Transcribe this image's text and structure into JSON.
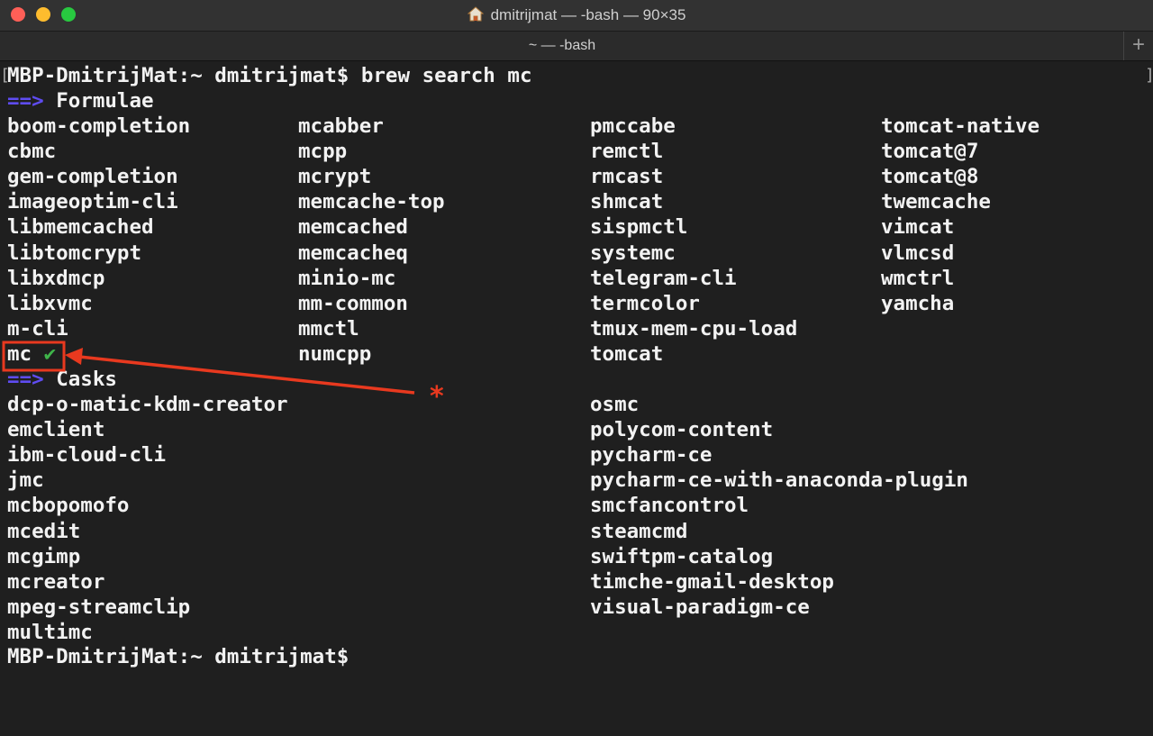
{
  "window": {
    "title": "dmitrijmat — -bash — 90×35",
    "tab_label": "~ — -bash",
    "new_tab_label": "+"
  },
  "terminal": {
    "prompt_command": "MBP-DmitrijMat:~ dmitrijmat$ brew search mc",
    "formulae_marker": "==>",
    "formulae_header": "Formulae",
    "formulae": [
      [
        "boom-completion",
        "mcabber",
        "pmccabe",
        "tomcat-native"
      ],
      [
        "cbmc",
        "mcpp",
        "remctl",
        "tomcat@7"
      ],
      [
        "gem-completion",
        "mcrypt",
        "rmcast",
        "tomcat@8"
      ],
      [
        "imageoptim-cli",
        "memcache-top",
        "shmcat",
        "twemcache"
      ],
      [
        "libmemcached",
        "memcached",
        "sispmctl",
        "vimcat"
      ],
      [
        "libtomcrypt",
        "memcacheq",
        "systemc",
        "vlmcsd"
      ],
      [
        "libxdmcp",
        "minio-mc",
        "telegram-cli",
        "wmctrl"
      ],
      [
        "libxvmc",
        "mm-common",
        "termcolor",
        "yamcha"
      ],
      [
        "m-cli",
        "mmctl",
        "tmux-mem-cpu-load",
        ""
      ],
      [
        "mc",
        "numcpp",
        "tomcat",
        ""
      ]
    ],
    "installed_check": "✔",
    "casks_marker": "==>",
    "casks_header": "Casks",
    "casks": [
      [
        "dcp-o-matic-kdm-creator",
        "osmc"
      ],
      [
        "emclient",
        "polycom-content"
      ],
      [
        "ibm-cloud-cli",
        "pycharm-ce"
      ],
      [
        "jmc",
        "pycharm-ce-with-anaconda-plugin"
      ],
      [
        "mcbopomofo",
        "smcfancontrol"
      ],
      [
        "mcedit",
        "steamcmd"
      ],
      [
        "mcgimp",
        "swiftpm-catalog"
      ],
      [
        "mcreator",
        "timche-gmail-desktop"
      ],
      [
        "mpeg-streamclip",
        "visual-paradigm-ce"
      ],
      [
        "multimc",
        ""
      ]
    ],
    "final_prompt": "MBP-DmitrijMat:~ dmitrijmat$"
  },
  "annotation": {
    "asterisk": "*",
    "color": "#e8391f"
  },
  "colors": {
    "background": "#1f1f1f",
    "text": "#f2f2f2",
    "marker": "#5f4cf2",
    "check": "#3fb54a"
  }
}
